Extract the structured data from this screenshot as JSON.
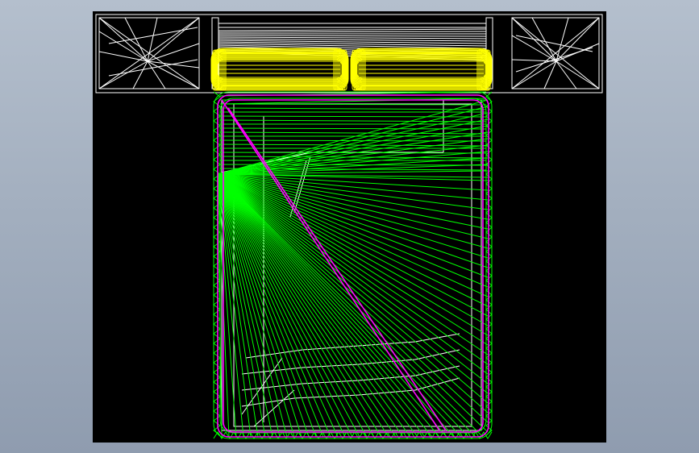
{
  "window": {
    "background": "#a9b4c4"
  },
  "viewport": {
    "background": "#000000",
    "model_colors": {
      "frame": "#ffffff",
      "pillows": "#ffff00",
      "mattress": "#00ff00",
      "border": "#ff00ff"
    },
    "view": "wireframe"
  }
}
